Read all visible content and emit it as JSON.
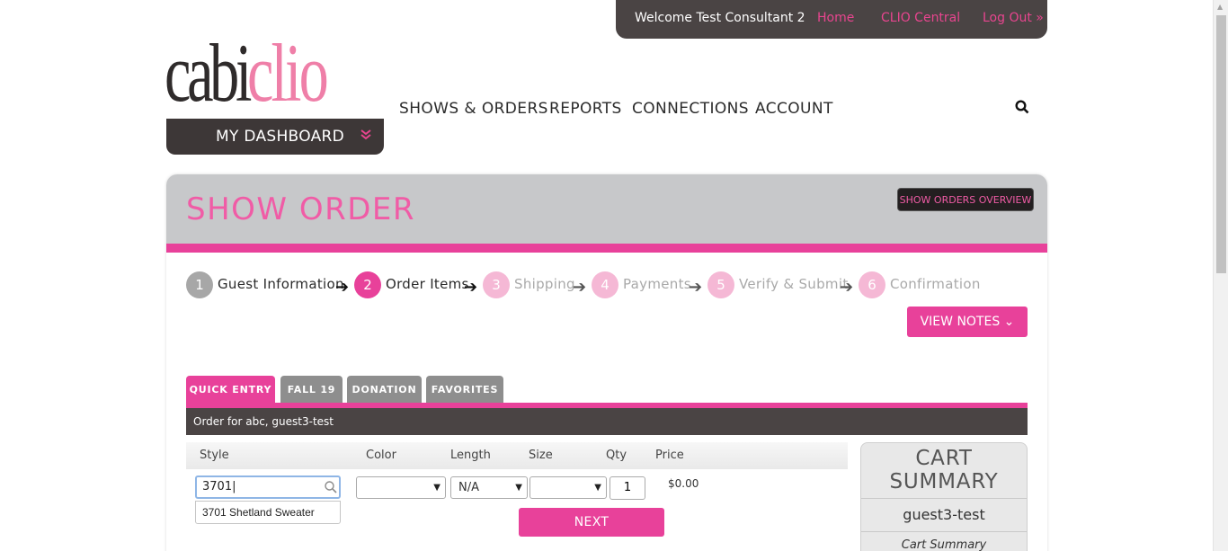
{
  "topbar": {
    "welcome": "Welcome Test Consultant 2",
    "home": "Home",
    "clio_central": "CLIO Central",
    "logout": "Log Out »"
  },
  "logo": {
    "part1": "cabi",
    "part2": "clio"
  },
  "dashboard": {
    "label": "MY DASHBOARD",
    "chevron": "»"
  },
  "nav": {
    "items": [
      "SHOWS & ORDERS",
      "REPORTS",
      "CONNECTIONS",
      "ACCOUNT"
    ]
  },
  "header": {
    "title": "SHOW ORDER",
    "overview_button": "SHOW ORDERS OVERVIEW"
  },
  "steps": [
    {
      "num": "1",
      "label": "Guest Information",
      "state": "done"
    },
    {
      "num": "2",
      "label": "Order Items",
      "state": "active"
    },
    {
      "num": "3",
      "label": "Shipping",
      "state": "todo"
    },
    {
      "num": "4",
      "label": "Payments",
      "state": "todo"
    },
    {
      "num": "5",
      "label": "Verify & Submit",
      "state": "todo"
    },
    {
      "num": "6",
      "label": "Confirmation",
      "state": "todo"
    }
  ],
  "notes_button": "VIEW NOTES ⌄",
  "tabs": [
    "QUICK ENTRY",
    "FALL 19",
    "DONATION",
    "FAVORITES"
  ],
  "order_for": "Order for abc, guest3-test",
  "columns": [
    "Style",
    "Color",
    "Length",
    "Size",
    "Qty",
    "Price"
  ],
  "form": {
    "style_value": "3701|",
    "suggestion": "3701 Shetland Sweater",
    "color_value": "",
    "length_value": "N/A",
    "size_value": "",
    "qty_value": "1",
    "price": "$0.00",
    "next_button": "NEXT"
  },
  "cart": {
    "title": "CART SUMMARY",
    "guest": "guest3-test",
    "subtitle": "Cart Summary"
  },
  "colors": {
    "accent_pink": "#e8419a",
    "dark": "#4a4444",
    "header_gray": "#c7c8ca"
  }
}
